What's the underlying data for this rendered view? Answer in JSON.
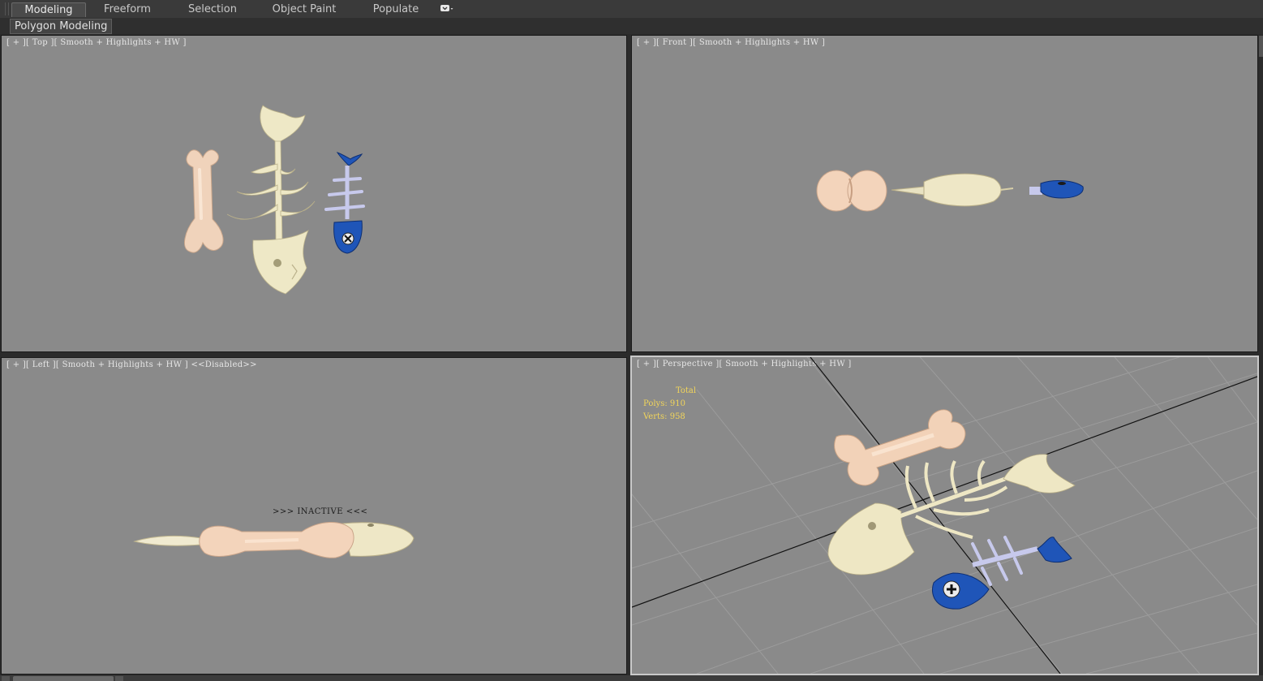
{
  "ribbon": {
    "tabs": [
      {
        "label": "Modeling",
        "active": true
      },
      {
        "label": "Freeform",
        "active": false
      },
      {
        "label": "Selection",
        "active": false
      },
      {
        "label": "Object Paint",
        "active": false
      },
      {
        "label": "Populate",
        "active": false
      }
    ],
    "options_icon": "dropdown-options-icon",
    "subtab": "Polygon Modeling"
  },
  "viewports": {
    "top": {
      "plus": "+",
      "view": "Top",
      "shading": "Smooth + Highlights + HW"
    },
    "front": {
      "plus": "+",
      "view": "Front",
      "shading": "Smooth + Highlights + HW"
    },
    "left": {
      "plus": "+",
      "view": "Left",
      "shading": "Smooth + Highlights + HW",
      "status": "<<Disabled>>",
      "inactive": ">>> INACTIVE <<<"
    },
    "perspective": {
      "plus": "+",
      "view": "Perspective",
      "shading": "Smooth + Highlights + HW",
      "stats": {
        "header": "Total",
        "polys": "Polys: 910",
        "verts": "Verts: 958"
      }
    }
  },
  "colors": {
    "viewport_bg": "#8a8a8a",
    "bone": "#f2d7c0",
    "fishbone": "#eee8c8",
    "blue_fish": "#1f55b8",
    "stats_text": "#f2d55a"
  }
}
